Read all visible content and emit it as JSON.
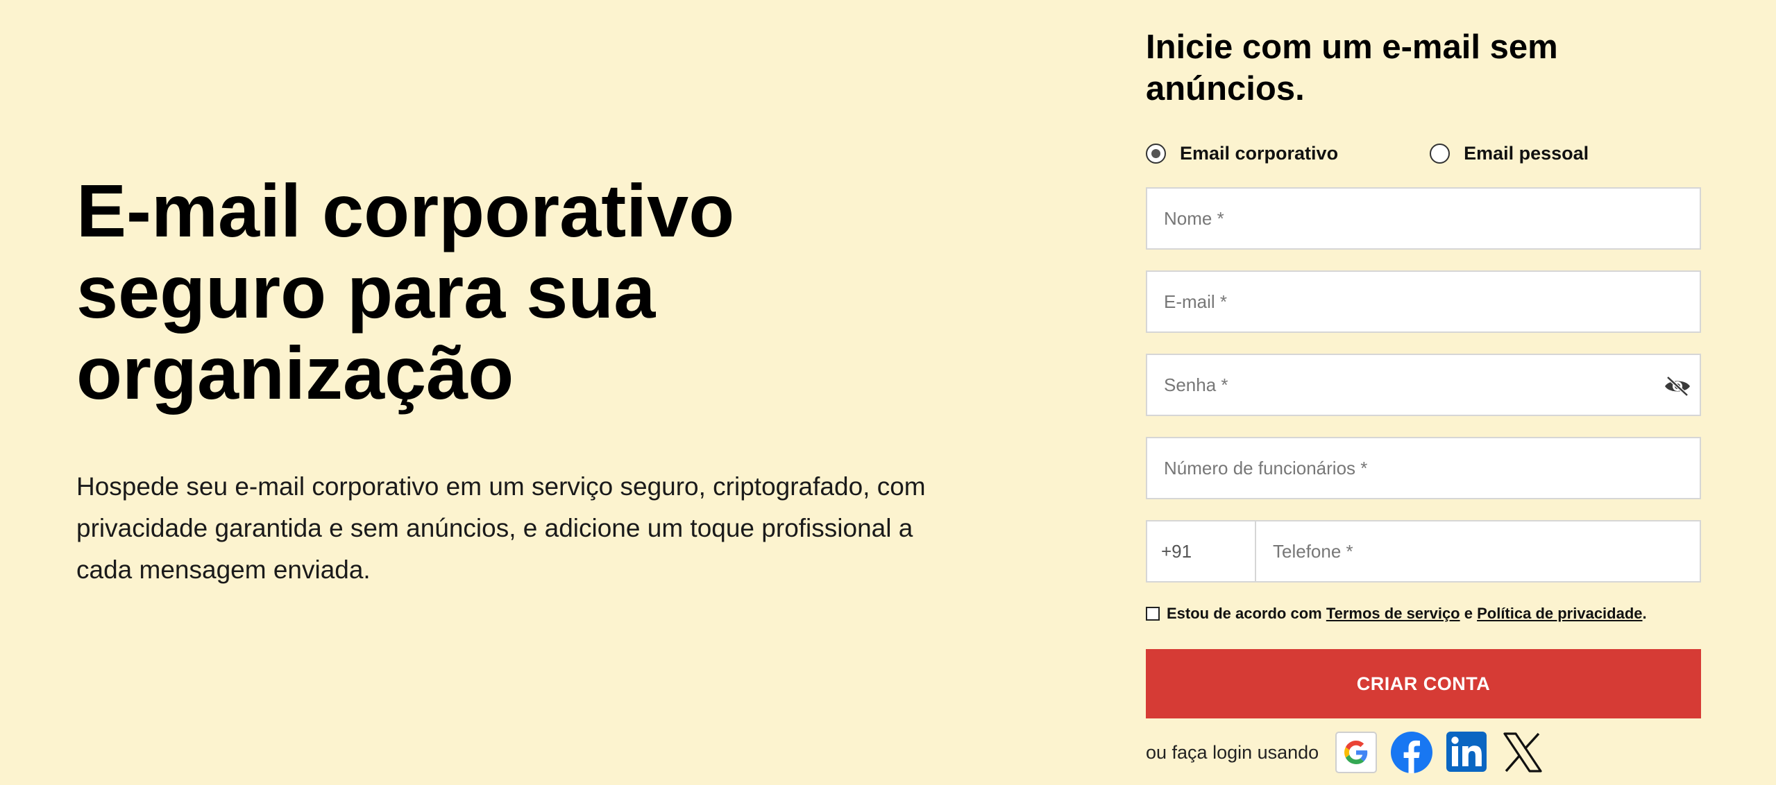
{
  "hero": {
    "title_line1": "E-mail corporativo",
    "title_line2": "seguro para sua",
    "title_line3": "organização",
    "subtitle": "Hospede seu e-mail corporativo em um serviço seguro, criptografado, com privacidade garantida e sem anúncios, e adicione um toque profissional a cada mensagem enviada."
  },
  "form": {
    "heading": "Inicie com um e-mail sem anúncios.",
    "radio_options": [
      {
        "label": "Email corporativo",
        "selected": true
      },
      {
        "label": "Email pessoal",
        "selected": false
      }
    ],
    "fields": {
      "name_placeholder": "Nome *",
      "email_placeholder": "E-mail *",
      "password_placeholder": "Senha *",
      "employees_placeholder": "Número de funcionários *",
      "country_code": "+91",
      "phone_placeholder": "Telefone *"
    },
    "terms": {
      "prefix": "Estou de acordo com ",
      "terms_link": "Termos de serviço",
      "conjunction": " e ",
      "privacy_link": "Política de privacidade",
      "suffix": ".",
      "checked": false
    },
    "submit_label": "CRIAR CONTA",
    "social": {
      "label": "ou faça login usando",
      "providers": [
        "google-icon",
        "facebook-icon",
        "linkedin-icon",
        "x-icon"
      ]
    }
  },
  "colors": {
    "background": "#fcf3cf",
    "cta": "#d63b35",
    "facebook": "#1877f2",
    "linkedin": "#0a66c2"
  }
}
